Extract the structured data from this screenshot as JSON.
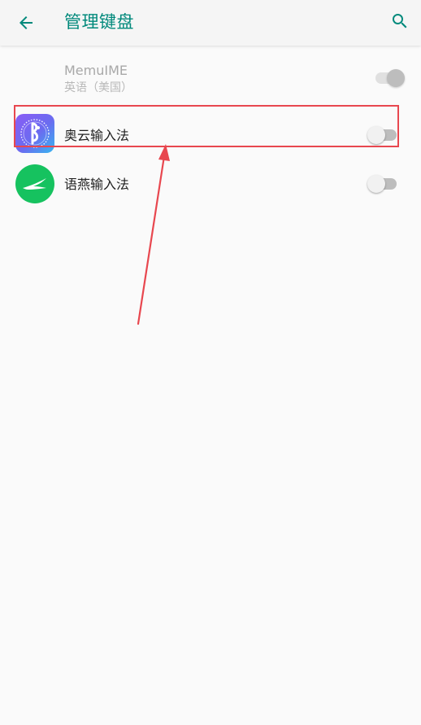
{
  "appbar": {
    "title": "管理键盘",
    "back_icon": "arrow-back-icon",
    "search_icon": "search-icon",
    "accent_color": "#00897b"
  },
  "keyboards": [
    {
      "name": "MemuIME",
      "subtitle": "英语（美国）",
      "enabled": true,
      "disabled_state": true
    },
    {
      "name": "奥云输入法",
      "icon": "aoyun-ime-icon",
      "enabled": false
    },
    {
      "name": "语燕输入法",
      "icon": "yuyan-ime-icon",
      "enabled": false
    }
  ],
  "annotation": {
    "color": "#e8474f"
  }
}
